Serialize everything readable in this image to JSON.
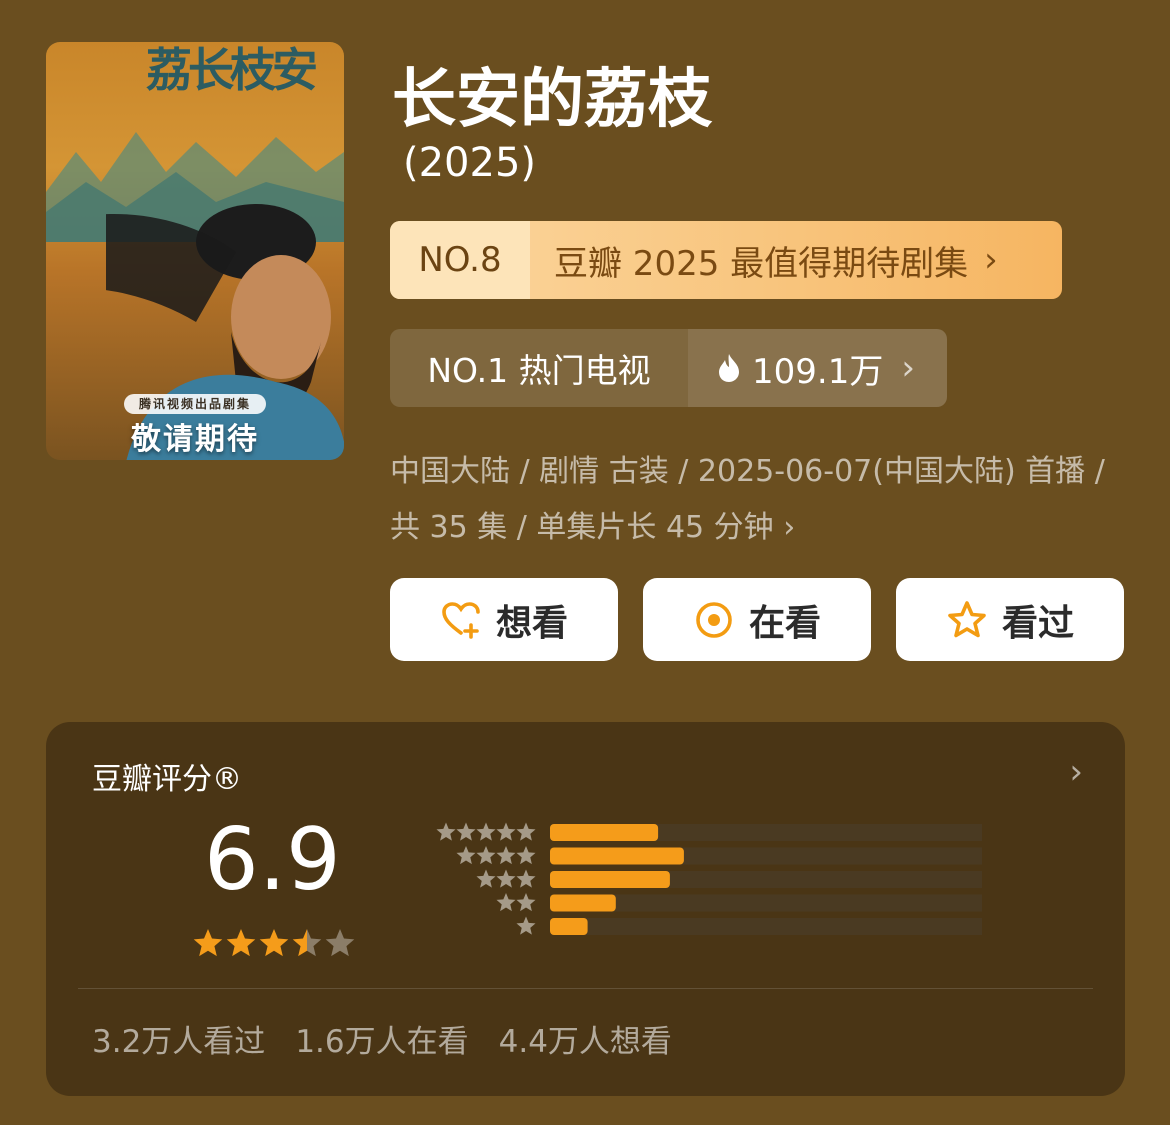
{
  "poster": {
    "title_glyphs": "荔长枝安",
    "producer_pill": "腾讯视频出品剧集",
    "cta": "敬请期待"
  },
  "title": "长安的荔枝",
  "year": "(2025)",
  "ranking_primary": {
    "rank": "NO.8",
    "label": "豆瓣 2025 最值得期待剧集"
  },
  "ranking_secondary": {
    "rank_label": "NO.1 热门电视",
    "heat": "109.1万"
  },
  "meta": "中国大陆 / 剧情 古装 / 2025-06-07(中国大陆) 首播 / 共 35 集 / 单集片长 45 分钟",
  "actions": {
    "want": "想看",
    "watching": "在看",
    "watched": "看过"
  },
  "rating": {
    "header": "豆瓣评分®",
    "score": "6.9",
    "stars": 3.5,
    "distribution": [
      {
        "stars": 5,
        "fraction": 0.23
      },
      {
        "stars": 4,
        "fraction": 0.285
      },
      {
        "stars": 3,
        "fraction": 0.255
      },
      {
        "stars": 2,
        "fraction": 0.14
      },
      {
        "stars": 1,
        "fraction": 0.08
      }
    ],
    "footer": [
      "3.2万人看过",
      "1.6万人在看",
      "4.4万人想看"
    ]
  },
  "colors": {
    "background": "#6a4e1f",
    "accent_orange": "#f59c1a",
    "track": "#4a3a22"
  }
}
